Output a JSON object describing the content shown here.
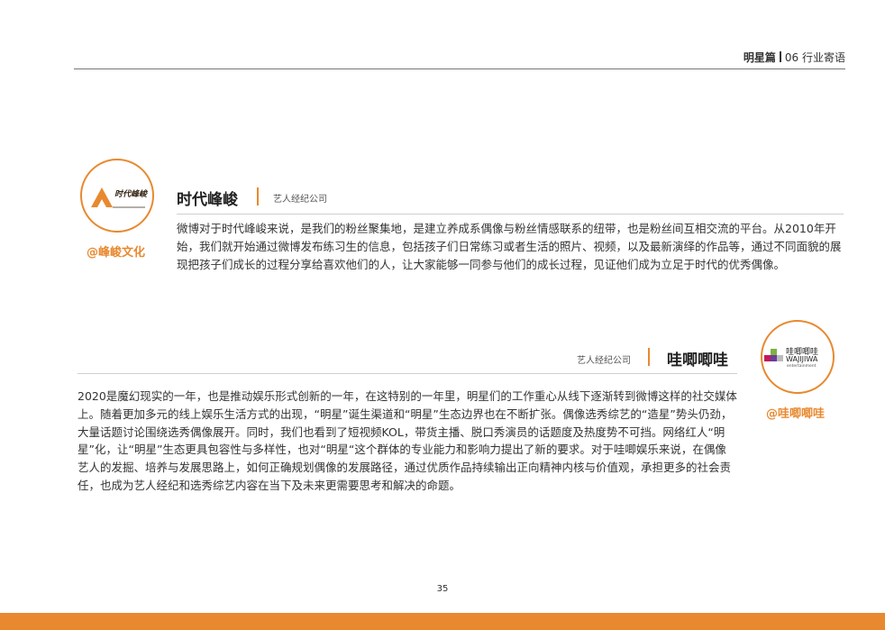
{
  "header": {
    "section": "明星篇",
    "subsection": "06 行业寄语"
  },
  "entries": [
    {
      "logo_text": "时代峰峻",
      "company": "时代峰峻",
      "category": "艺人经纪公司",
      "handle": "@峰峻文化",
      "text": "微博对于时代峰峻来说，是我们的粉丝聚集地，是建立养成系偶像与粉丝情感联系的纽带，也是粉丝间互相交流的平台。从2010年开始，我们就开始通过微博发布练习生的信息，包括孩子们日常练习或者生活的照片、视频，以及最新演绎的作品等，通过不同面貌的展现把孩子们成长的过程分享给喜欢他们的人，让大家能够一同参与他们的成长过程，见证他们成为立足于时代的优秀偶像。"
    },
    {
      "logo_text": "哇唧唧哇",
      "logo_latin": "WAJIJIWA",
      "logo_sub": "entertainment",
      "company": "哇唧唧哇",
      "category": "艺人经纪公司",
      "handle": "@哇唧唧哇",
      "text": "2020是魔幻现实的一年，也是推动娱乐形式创新的一年，在这特别的一年里，明星们的工作重心从线下逐渐转到微博这样的社交媒体上。随着更加多元的线上娱乐生活方式的出现，“明星”诞生渠道和“明星”生态边界也在不断扩张。偶像选秀综艺的“造星”势头仍劲，大量话题讨论围绕选秀偶像展开。同时，我们也看到了短视频KOL，带货主播、脱口秀演员的话题度及热度势不可挡。网络红人“明星”化，让“明星”生态更具包容性与多样性，也对“明星“这个群体的专业能力和影响力提出了新的要求。对于哇唧娱乐来说，在偶像艺人的发掘、培养与发展思路上，如何正确规划偶像的发展路径，通过优质作品持续输出正向精神内核与价值观，承担更多的社会责任，也成为艺人经纪和选秀综艺内容在当下及未来更需要思考和解决的命题。"
    }
  ],
  "page_number": "35",
  "colors": {
    "accent": "#e8892f",
    "logo_dark": "#3a2a1a",
    "logo_pink": "#c2185b",
    "logo_green": "#7cb342",
    "logo_purple": "#6a3d9a"
  }
}
